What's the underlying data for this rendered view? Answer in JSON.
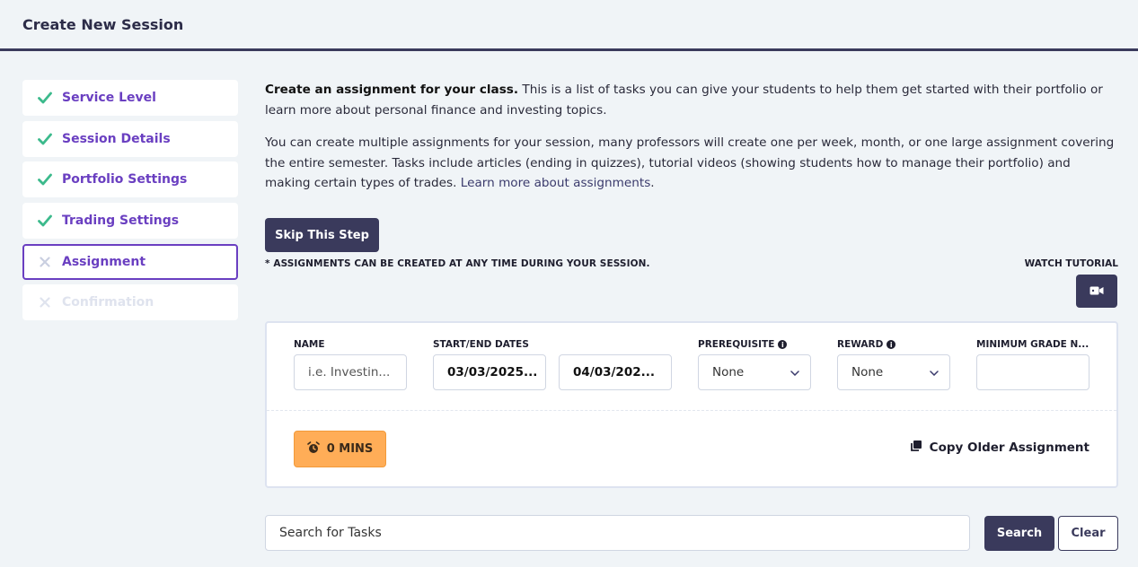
{
  "header": {
    "title": "Create New Session"
  },
  "steps": [
    {
      "label": "Service Level",
      "state": "done"
    },
    {
      "label": "Session Details",
      "state": "done"
    },
    {
      "label": "Portfolio Settings",
      "state": "done"
    },
    {
      "label": "Trading Settings",
      "state": "done"
    },
    {
      "label": "Assignment",
      "state": "active"
    },
    {
      "label": "Confirmation",
      "state": "disabled"
    }
  ],
  "intro": {
    "bold": "Create an assignment for your class.",
    "text": " This is a list of tasks you can give your students to help them get started with their portfolio or learn more about personal finance and investing topics.",
    "para2": "You can create multiple assignments for your session, many professors will create one per week, month, or one large assignment covering the entire semester. Tasks include articles (ending in quizzes), tutorial videos (showing students how to manage their portfolio) and making certain types of trades. ",
    "link": "Learn more about assignments",
    "link_suffix": "."
  },
  "skip_button": "Skip This Step",
  "note": "* ASSIGNMENTS CAN BE CREATED AT ANY TIME DURING YOUR SESSION.",
  "watch_tutorial": "WATCH TUTORIAL",
  "form": {
    "name_label": "NAME",
    "name_placeholder": "i.e. Investin...",
    "dates_label": "START/END DATES",
    "start_date": "03/03/2025...",
    "end_date": "04/03/202...",
    "prereq_label": "PREREQUISITE",
    "prereq_value": "None",
    "reward_label": "REWARD",
    "reward_value": "None",
    "min_grade_label": "MINIMUM GRADE N...",
    "min_grade_value": ""
  },
  "mins_button": "0 MINS",
  "copy_older": "Copy Older Assignment",
  "search": {
    "placeholder": "Search for Tasks",
    "search_label": "Search",
    "clear_label": "Clear"
  },
  "colors": {
    "accent": "#6a3fc1",
    "dark": "#3a3a5c",
    "check": "#3cba8c",
    "orange": "#ffad57"
  }
}
